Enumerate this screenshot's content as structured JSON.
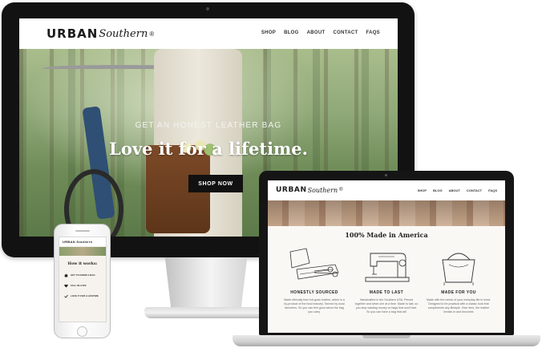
{
  "brand": {
    "name_bold": "URBAN",
    "name_script": "Southern",
    "registered_mark": "®"
  },
  "desktop": {
    "nav": [
      "SHOP",
      "BLOG",
      "ABOUT",
      "CONTACT",
      "FAQS"
    ],
    "hero": {
      "tagline": "GET AN HONEST LEATHER BAG",
      "title": "Love it for a lifetime.",
      "button_label": "SHOP NOW"
    }
  },
  "laptop": {
    "nav": [
      "SHOP",
      "BLOG",
      "ABOUT",
      "CONTACT",
      "FAQS"
    ],
    "heading": "100% Made in America",
    "features": [
      {
        "title": "HONESTLY SOURCED",
        "text": "Made ethically from full-grain leather, which is a by-product of the food industry. Tanned by local tanneries. So you can feel good about the bag you carry."
      },
      {
        "title": "MADE TO LAST",
        "text": "Handcrafted in the Southern USA. Pieced together and sewn one at a time. Made to last, so you stop wasting money on bags that won't last. So you can have a bag that will"
      },
      {
        "title": "MADE FOR YOU",
        "text": "Made with the needs of your everyday life in mind. Designed to be practical with a classic look that compliments any lifestyle. Over time, the leather breaks in and becomes"
      }
    ]
  },
  "phone": {
    "logo": "URBAN Southern",
    "title": "How it works:",
    "steps": [
      {
        "label": "GET TO KNOW A BAG",
        "icon": "bag-icon"
      },
      {
        "label": "FALL IN LOVE",
        "icon": "heart-icon"
      },
      {
        "label": "LOVE IT FOR A LIFETIME",
        "icon": "check-icon"
      }
    ]
  },
  "colors": {
    "device_black": "#121212",
    "hero_button": "#111111",
    "leather_brown": "#7c4a28"
  }
}
